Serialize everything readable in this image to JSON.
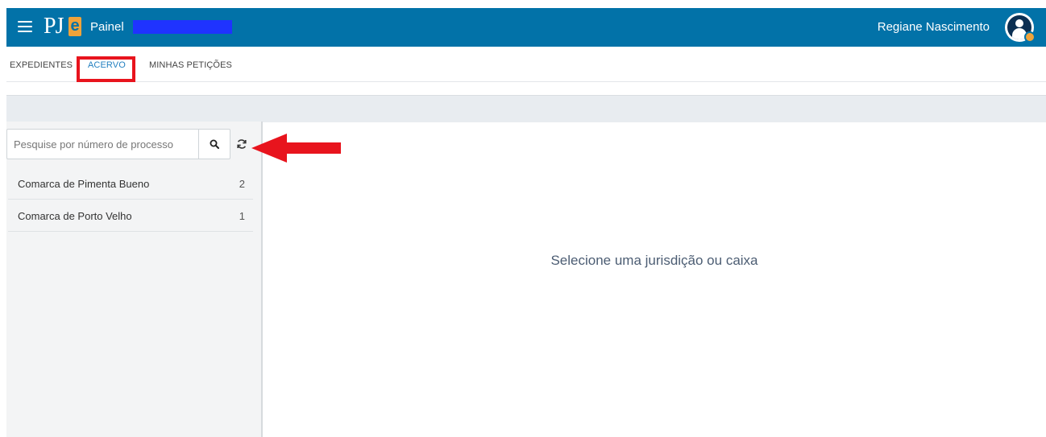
{
  "header": {
    "logo_text": "PJ",
    "logo_e": "e",
    "title": "Painel",
    "user_name": "Regiane Nascimento"
  },
  "tabs": [
    {
      "label": "EXPEDIENTES"
    },
    {
      "label": "ACERVO",
      "active": true
    },
    {
      "label": "MINHAS PETIÇÕES"
    }
  ],
  "search": {
    "value": "",
    "placeholder": "Pesquise por número de processo"
  },
  "jurisdictions": [
    {
      "label": "Comarca de Pimenta Bueno",
      "count": "2"
    },
    {
      "label": "Comarca de Porto Velho",
      "count": "1"
    }
  ],
  "main": {
    "empty_message": "Selecione uma jurisdição ou caixa"
  },
  "colors": {
    "header_bg": "#0272a8",
    "accent_orange": "#f0a33a",
    "active_tab": "#2380c0",
    "annotation_red": "#e8141d",
    "redaction": "#1f33ff"
  },
  "icons": [
    "menu-icon",
    "search-icon",
    "refresh-icon",
    "user-avatar-icon"
  ]
}
